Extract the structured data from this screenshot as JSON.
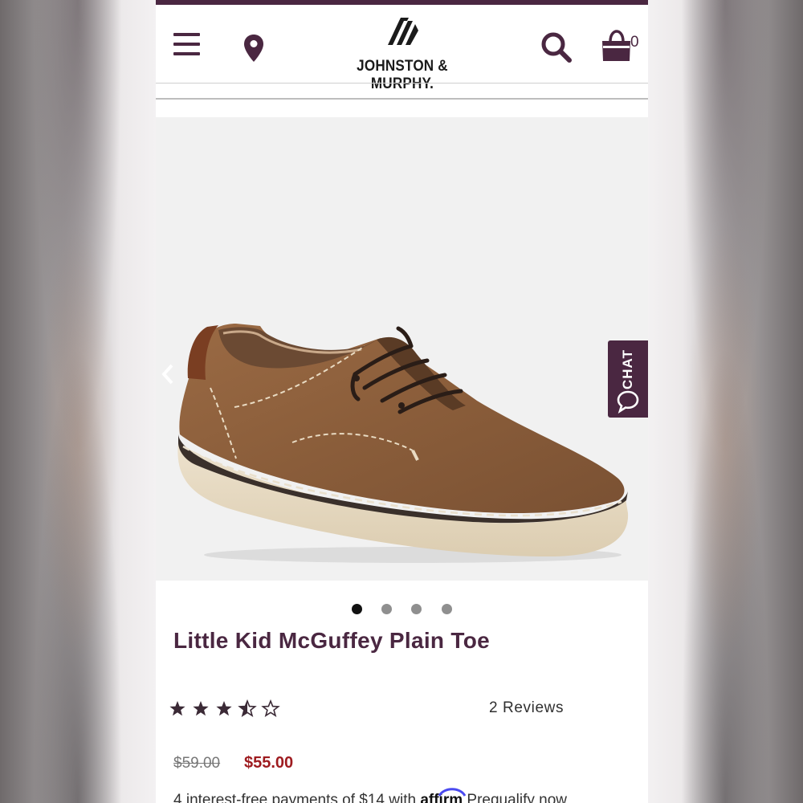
{
  "header": {
    "logo_text": "JOHNSTON & MURPHY.",
    "cart_count": "0",
    "icons": [
      "menu-icon",
      "location-pin-icon",
      "search-icon",
      "shopping-bag-icon"
    ]
  },
  "chat": {
    "label": "CHAT"
  },
  "gallery": {
    "image_count": 4,
    "active_index": 0
  },
  "product": {
    "title": "Little Kid McGuffey Plain Toe",
    "rating": 3.5,
    "rating_max": 5,
    "reviews_label": "2 Reviews",
    "price_original": "$59.00",
    "price_sale": "$55.00",
    "installments_prefix": "4 interest-free payments of $14 with ",
    "affirm_label": "affirm",
    "prequalify_label": "Prequalify now"
  },
  "colors": {
    "brand_plum": "#4a2741",
    "sale_red": "#9e1b1f"
  }
}
